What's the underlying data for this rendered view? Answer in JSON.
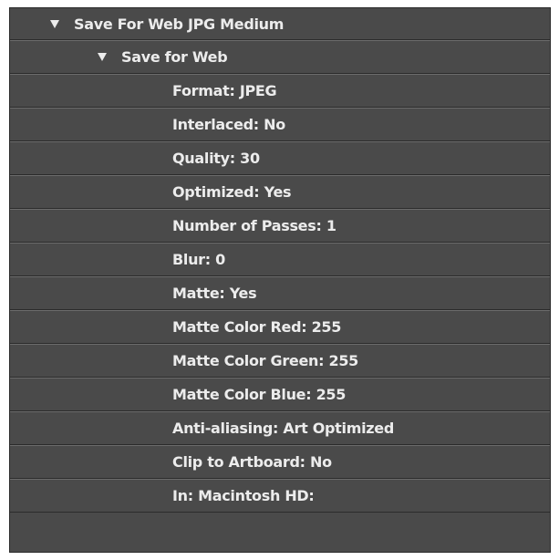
{
  "actions": {
    "set_name": "Save For Web JPG Medium",
    "step_name": "Save for Web",
    "properties": [
      "Format: JPEG",
      "Interlaced: No",
      "Quality: 30",
      "Optimized: Yes",
      "Number of Passes: 1",
      "Blur: 0",
      "Matte: Yes",
      "Matte Color Red: 255",
      "Matte Color Green: 255",
      "Matte Color Blue: 255",
      "Anti-aliasing: Art Optimized",
      "Clip to Artboard: No",
      "In: Macintosh HD:"
    ]
  },
  "icons": {
    "set_toggle": "expanded-triangle-icon",
    "step_toggle": "expanded-triangle-icon"
  },
  "colors": {
    "row_background": "#4a4a4a",
    "text": "#ececec",
    "row_highlight": "#6c6c6c",
    "row_shadow": "#2b2b2b"
  }
}
